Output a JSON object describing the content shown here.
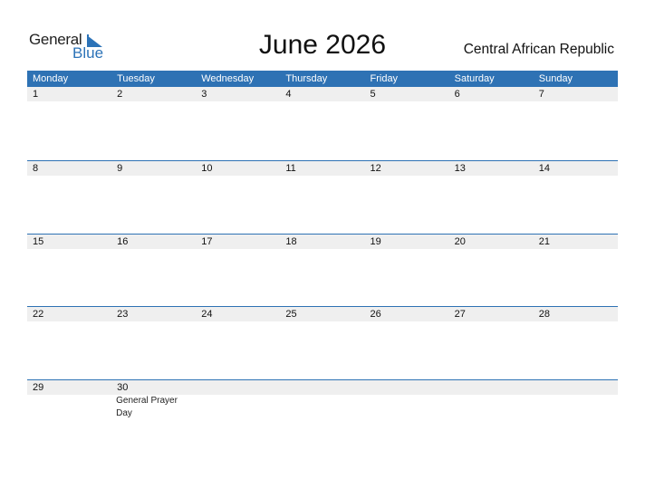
{
  "logo": {
    "line1": "General",
    "line2": "Blue"
  },
  "title": "June 2026",
  "country": "Central African Republic",
  "weekdays": [
    "Monday",
    "Tuesday",
    "Wednesday",
    "Thursday",
    "Friday",
    "Saturday",
    "Sunday"
  ],
  "weeks": [
    {
      "days": [
        "1",
        "2",
        "3",
        "4",
        "5",
        "6",
        "7"
      ],
      "events": [
        "",
        "",
        "",
        "",
        "",
        "",
        ""
      ]
    },
    {
      "days": [
        "8",
        "9",
        "10",
        "11",
        "12",
        "13",
        "14"
      ],
      "events": [
        "",
        "",
        "",
        "",
        "",
        "",
        ""
      ]
    },
    {
      "days": [
        "15",
        "16",
        "17",
        "18",
        "19",
        "20",
        "21"
      ],
      "events": [
        "",
        "",
        "",
        "",
        "",
        "",
        ""
      ]
    },
    {
      "days": [
        "22",
        "23",
        "24",
        "25",
        "26",
        "27",
        "28"
      ],
      "events": [
        "",
        "",
        "",
        "",
        "",
        "",
        ""
      ]
    },
    {
      "days": [
        "29",
        "30",
        "",
        "",
        "",
        "",
        ""
      ],
      "events": [
        "",
        "General Prayer Day",
        "",
        "",
        "",
        "",
        ""
      ]
    }
  ],
  "colors": {
    "accent": "#2e72b4",
    "day_band": "#efefef"
  }
}
